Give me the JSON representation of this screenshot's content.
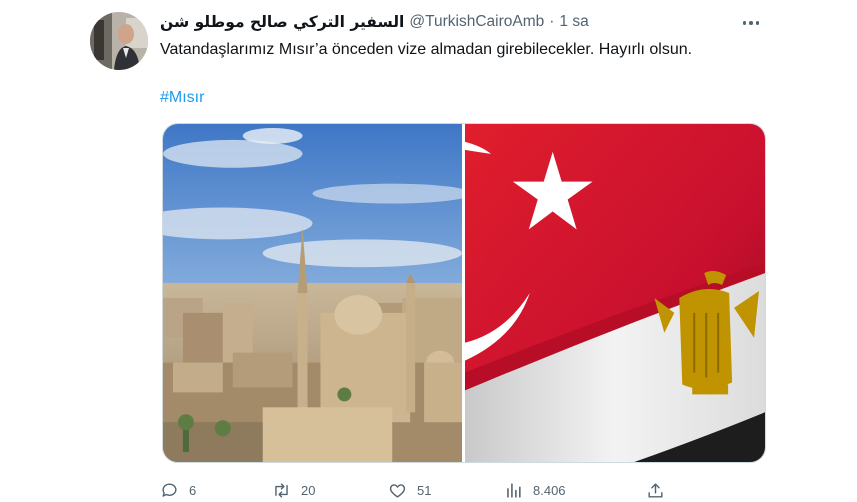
{
  "tweet": {
    "display_name": "السفير التركي صالح موطلو شن",
    "handle": "@TurkishCairoAmb",
    "separator": "·",
    "time": "1 sa",
    "text": "Vatandaşlarımız Mısır’a önceden vize almadan girebilecekler. Hayırlı olsun.",
    "hashtag": "#Mısır"
  },
  "actions": {
    "replies": "6",
    "retweets": "20",
    "likes": "51",
    "views": "8.406"
  },
  "colors": {
    "accent": "#1d9bf0",
    "secondary_text": "#536471",
    "turkey_red": "#c8102e",
    "egypt_eagle_gold": "#c09300"
  }
}
